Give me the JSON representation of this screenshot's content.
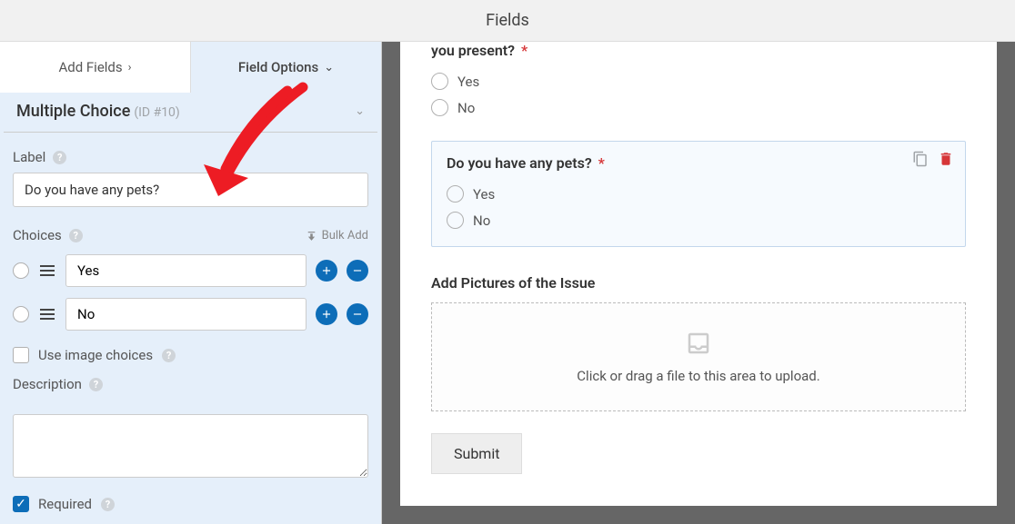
{
  "header": {
    "title": "Fields"
  },
  "tabs": {
    "add": "Add Fields",
    "options": "Field Options"
  },
  "section": {
    "name": "Multiple Choice",
    "idtxt": "(ID #10)"
  },
  "labels": {
    "label": "Label",
    "choices": "Choices",
    "bulk": "Bulk Add",
    "image_choices": "Use image choices",
    "description": "Description",
    "required": "Required"
  },
  "inputs": {
    "label_value": "Do you have any pets?",
    "choices": [
      "Yes",
      "No"
    ]
  },
  "preview": {
    "q1": {
      "title": "you present?",
      "opts": [
        "Yes",
        "No"
      ]
    },
    "q2": {
      "title": "Do you have any pets?",
      "opts": [
        "Yes",
        "No"
      ]
    },
    "upload": {
      "label": "Add Pictures of the Issue",
      "hint": "Click or drag a file to this area to upload."
    },
    "submit": "Submit"
  }
}
